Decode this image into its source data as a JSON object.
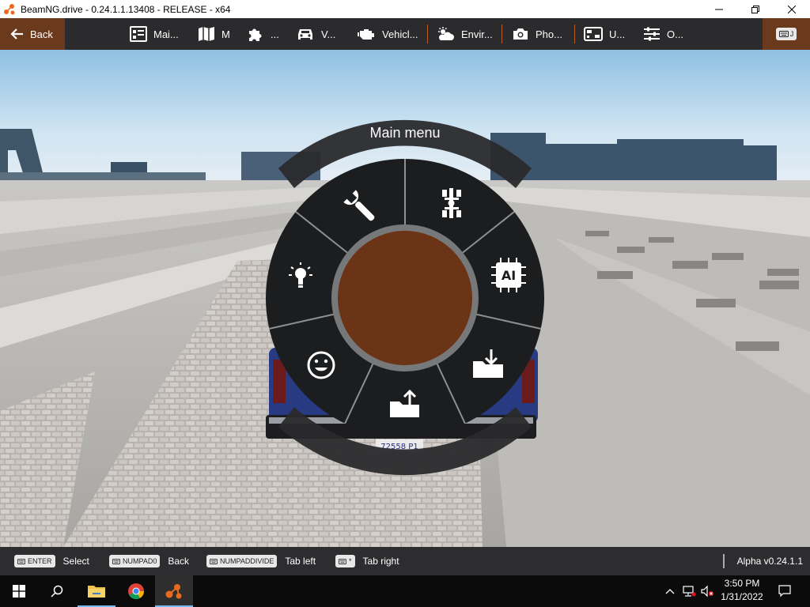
{
  "window": {
    "title": "BeamNG.drive - 0.24.1.1.13408 - RELEASE - x64"
  },
  "topbar": {
    "back_label": "Back",
    "tabs": [
      {
        "label": "Mai...",
        "icon": "main-menu-icon"
      },
      {
        "label": "M",
        "icon": "map-icon"
      },
      {
        "label": "...",
        "icon": "mods-icon"
      },
      {
        "label": "V...",
        "icon": "vehicles-icon"
      },
      {
        "label": "Vehicl...",
        "icon": "vehicle-config-icon"
      },
      {
        "label": "Envir...",
        "icon": "environment-icon"
      },
      {
        "label": "Pho...",
        "icon": "camera-icon"
      },
      {
        "label": "U...",
        "icon": "ui-apps-icon"
      },
      {
        "label": "O...",
        "icon": "options-icon"
      }
    ],
    "right_key": "J"
  },
  "radial_menu": {
    "title": "Main menu",
    "center_color": "#6b3416",
    "slices": [
      {
        "name": "repair",
        "icon": "wrench-icon"
      },
      {
        "name": "vehicle-parts",
        "icon": "chassis-icon"
      },
      {
        "name": "ai",
        "icon": "ai-chip-icon"
      },
      {
        "name": "load",
        "icon": "folder-load-icon"
      },
      {
        "name": "save",
        "icon": "folder-save-icon"
      },
      {
        "name": "emotes",
        "icon": "smiley-icon"
      },
      {
        "name": "lights",
        "icon": "lightbulb-icon"
      }
    ]
  },
  "license_plate": "72558 P1",
  "hintbar": {
    "hints": [
      {
        "key": "ENTER",
        "label": "Select"
      },
      {
        "key": "NUMPAD0",
        "label": "Back"
      },
      {
        "key": "NUMPADDIVIDE",
        "label": "Tab left"
      },
      {
        "key": "*",
        "label": "Tab right"
      }
    ],
    "version": "Alpha v0.24.1.1"
  },
  "taskbar": {
    "time": "3:50 PM",
    "date": "1/31/2022"
  },
  "colors": {
    "accent": "#b85c28",
    "back_button": "#6b3a1d",
    "menu_dark": "#1c1d1f"
  }
}
